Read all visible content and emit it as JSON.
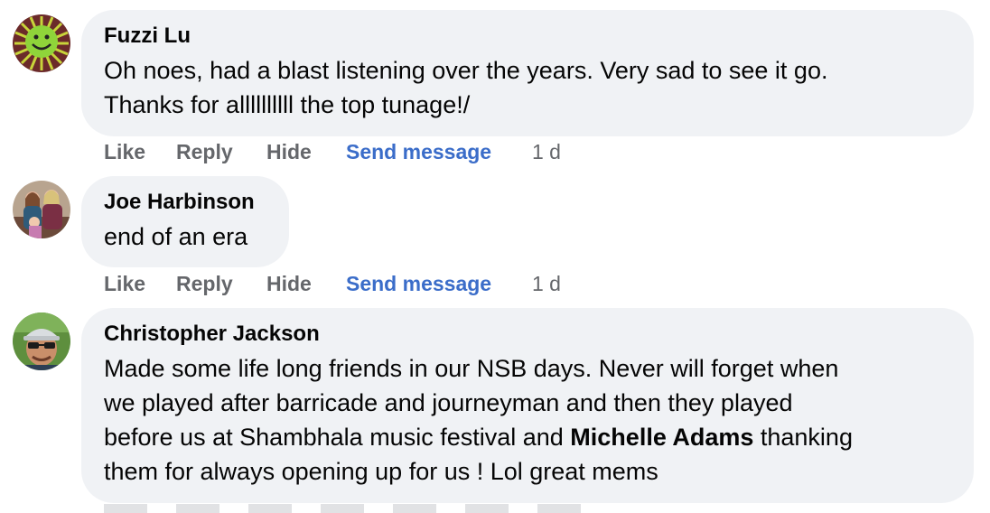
{
  "comments": [
    {
      "author": "Fuzzi Lu",
      "lines": [
        "Oh noes, had a blast listening over the years. Very sad to see it go.",
        "Thanks for allllllllll the top tunage!/"
      ],
      "actions": {
        "like": "Like",
        "reply": "Reply",
        "hide": "Hide",
        "send": "Send message",
        "time": "1 d"
      },
      "avatar_icon": "green-smiley-virus-avatar"
    },
    {
      "author": "Joe Harbinson",
      "lines": [
        "end of an era"
      ],
      "actions": {
        "like": "Like",
        "reply": "Reply",
        "hide": "Hide",
        "send": "Send message",
        "time": "1 d"
      },
      "avatar_icon": "family-photo-avatar"
    },
    {
      "author": "Christopher Jackson",
      "lines": [
        "Made some life long friends in our NSB days. Never will forget when",
        "we played after barricade and journeyman and then they played",
        "before us at Shambhala music festival and ",
        "them for always opening up for us ! Lol great mems"
      ],
      "mention": "Michelle Adams",
      "line3_suffix": " thanking",
      "avatar_icon": "man-with-cap-avatar"
    }
  ],
  "colors": {
    "bubble": "#f0f2f5",
    "action_gray": "#65676b",
    "send_blue": "#3b6dc9",
    "text": "#050505"
  }
}
